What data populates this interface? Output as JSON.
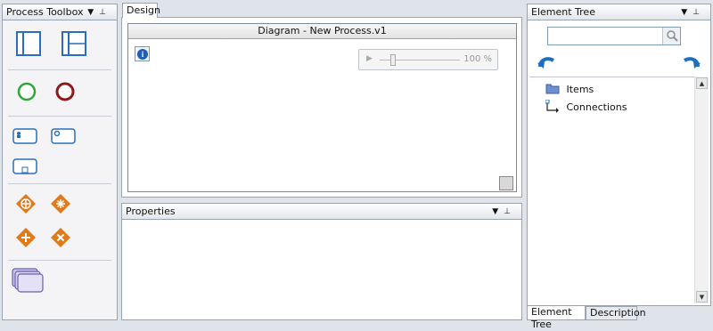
{
  "toolbox": {
    "title": "Process Toolbox",
    "tools": [
      {
        "name": "pool-tool",
        "icon": "pool-horizontal-icon"
      },
      {
        "name": "lane-tool",
        "icon": "pool-lanes-icon"
      },
      {
        "name": "start-event-tool",
        "icon": "start-event-icon"
      },
      {
        "name": "end-event-tool",
        "icon": "end-event-icon"
      },
      {
        "name": "user-task-tool",
        "icon": "user-task-icon"
      },
      {
        "name": "service-task-tool",
        "icon": "service-task-icon"
      },
      {
        "name": "subprocess-tool",
        "icon": "subprocess-icon"
      },
      {
        "name": "parallel-gateway-tool",
        "icon": "parallel-gateway-icon"
      },
      {
        "name": "complex-gateway-tool",
        "icon": "complex-gateway-icon"
      },
      {
        "name": "inclusive-gateway-tool",
        "icon": "inclusive-gateway-icon"
      },
      {
        "name": "event-gateway-tool",
        "icon": "event-gateway-icon"
      },
      {
        "name": "collection-tool",
        "icon": "stacked-pages-icon"
      }
    ]
  },
  "design": {
    "tab_label": "Design",
    "diagram_title": "Diagram - New Process.v1",
    "info_label": "i",
    "zoom_play": "▶",
    "zoom_value": "100 %"
  },
  "properties": {
    "title": "Properties"
  },
  "element_tree": {
    "title": "Element Tree",
    "search_placeholder": "",
    "items": [
      {
        "label": "Items",
        "icon": "folder-icon"
      },
      {
        "label": "Connections",
        "icon": "connector-icon"
      }
    ],
    "tabs": [
      "Element Tree",
      "Description"
    ]
  },
  "panel_buttons": {
    "dropdown": "▼",
    "pin": "⊥"
  },
  "scroll": {
    "up": "▲",
    "down": "▼"
  },
  "colors": {
    "start_event": "#2ea63a",
    "end_event": "#8b1a1a",
    "gateway": "#e07a1a",
    "task": "#2a6ebb",
    "arrow": "#1f6fbf"
  }
}
